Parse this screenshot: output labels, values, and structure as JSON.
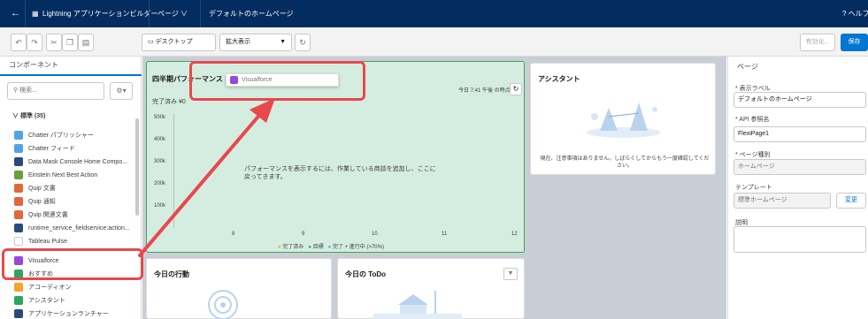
{
  "topbar": {
    "back_icon": "arrow-left-icon",
    "app_title": "Lightning アプリケーションビルダー",
    "pages_menu": "ページ ∨",
    "page_name": "デフォルトのホームページ",
    "help": "? ヘルプ"
  },
  "toolbar": {
    "device": "デスクトップ",
    "zoom": "拡大表示",
    "save_draft": "有効化...",
    "save": "保存"
  },
  "left": {
    "tab": "コンポーネント",
    "search_placeholder": "検索...",
    "section": "標準 (35)",
    "items": [
      {
        "label": "Chatter パブリッシャー",
        "color": "#4fa4e6"
      },
      {
        "label": "Chatter フィード",
        "color": "#4fa4e6"
      },
      {
        "label": "Data Mask Console Home Compo...",
        "color": "#2b4a7a"
      },
      {
        "label": "Einstein Next Best Action",
        "color": "#6a9e3f"
      },
      {
        "label": "Quip 文書",
        "color": "#e2673a"
      },
      {
        "label": "Quip 通知",
        "color": "#e2673a"
      },
      {
        "label": "Quip 関連文書",
        "color": "#e2673a"
      },
      {
        "label": "runtime_service_fieldservice:action...",
        "color": "#2b4a7a"
      },
      {
        "label": "Tableau Pulse",
        "color": "#ffffff"
      },
      {
        "label": "Visualforce",
        "color": "#9a47d8"
      },
      {
        "label": "おすすめ",
        "color": "#2aa65f"
      },
      {
        "label": "アコーディオン",
        "color": "#f5a42c"
      },
      {
        "label": "アシスタント",
        "color": "#2aa65f"
      },
      {
        "label": "アプリケーションランチャー",
        "color": "#2b4a7a"
      }
    ]
  },
  "canvas": {
    "perf_title": "四半期パフォーマンス",
    "drag_chip": "Visualforce",
    "complete_label": "完了済み",
    "complete_value": "¥0",
    "as_of": "今日 7:41 午後 の時点",
    "chart_msg": "パフォーマンスを表示するには、作業している商談を追加し、ここに戻ってきます。",
    "y_ticks": [
      "500k",
      "400k",
      "300k",
      "200k",
      "100k"
    ],
    "x_ticks": [
      "8",
      "9",
      "10",
      "11",
      "12"
    ],
    "legend": [
      "完了済み",
      "目標",
      "完了 + 進行中 (>70%)"
    ],
    "assistant_title": "アシスタント",
    "assistant_msg": "現在、注意事項はありません。しばらくしてからもう一度確認してください。",
    "events_title": "今日の行動",
    "todo_title": "今日の ToDo"
  },
  "right": {
    "heading": "ページ",
    "label_label": "* 表示ラベル",
    "label_value": "デフォルトのホームページ",
    "api_label": "* API 参照名",
    "api_value": "FlexiPage1",
    "type_label": "* ページ種別",
    "type_value": "ホームページ",
    "template_label": "テンプレート",
    "template_value": "標準ホームページ",
    "change": "変更",
    "desc_label": "説明"
  },
  "colors": {
    "topbar": "#032d60",
    "brand": "#0176d3",
    "highlight": "#e8484d",
    "drop_zone": "#d5ede0"
  }
}
